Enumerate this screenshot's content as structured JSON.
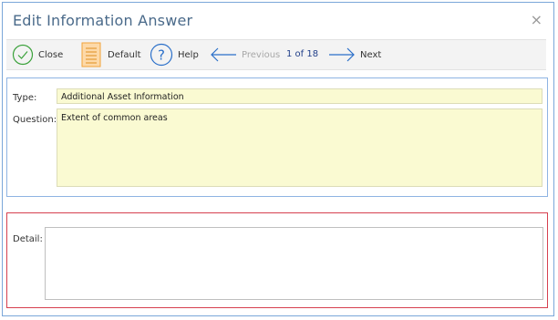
{
  "dialog": {
    "title": "Edit Information Answer",
    "close_glyph": "×"
  },
  "toolbar": {
    "close_label": "Close",
    "default_label": "Default",
    "help_label": "Help",
    "previous_label": "Previous",
    "counter": "1 of 18",
    "next_label": "Next",
    "icons": {
      "close": "check-circle-icon",
      "default": "document-icon",
      "help": "question-circle-icon",
      "previous": "arrow-left-icon",
      "next": "arrow-right-icon"
    }
  },
  "form": {
    "type_label": "Type:",
    "type_value": "Additional Asset Information",
    "question_label": "Question:",
    "question_value": "Extent of common areas",
    "detail_label": "Detail:",
    "detail_value": ""
  },
  "colors": {
    "accent_border": "#8eb4e3",
    "error_border": "#d6404f",
    "readonly_bg": "#fafad2",
    "check_green": "#3aa13a",
    "help_blue": "#2a6fc9",
    "doc_orange": "#f2a33a"
  }
}
